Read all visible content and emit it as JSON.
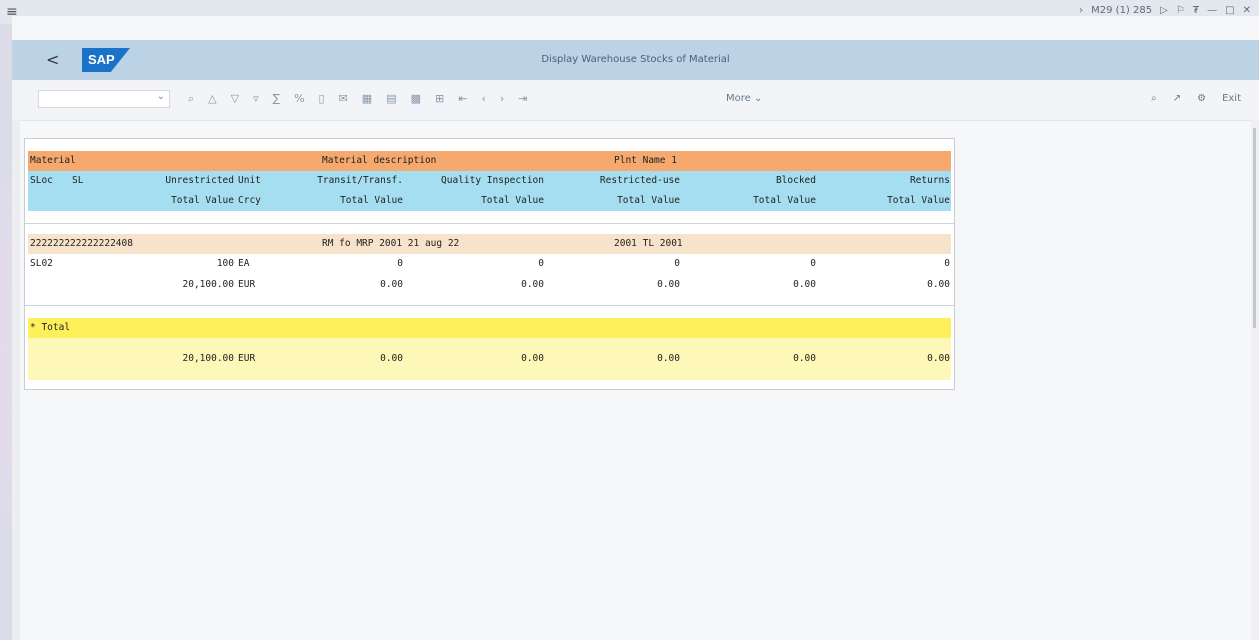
{
  "colors": {
    "header_orange": "#f5a96e",
    "header_blue": "#a5def0",
    "group_row": "#f7e3cc",
    "total_yellow": "#fdf05a",
    "total_values": "#fdf8b8",
    "sap_blue": "#1a73c9"
  },
  "titlebar": {
    "menu_icon": "hamburger-icon",
    "session": "M29 (1) 285",
    "icons": [
      "forward-icon",
      "play-icon",
      "flag-icon",
      "help-icon",
      "minimize-icon",
      "maximize-icon",
      "close-icon"
    ]
  },
  "shell": {
    "back": "<",
    "logo": "SAP",
    "title": "Display Warehouse Stocks of Material"
  },
  "toolbar": {
    "icons": [
      "find-icon",
      "sort-asc-icon",
      "sort-desc-icon",
      "filter-icon",
      "sum-icon",
      "subtotal-icon",
      "print-icon",
      "mail-icon",
      "layout-icon",
      "grid-icon",
      "export-icon",
      "spreadsheet-icon",
      "first-page-icon",
      "prev-page-icon",
      "next-page-icon",
      "last-page-icon"
    ],
    "more": "More",
    "right_icons": [
      "search-icon",
      "share-icon",
      "settings-icon"
    ],
    "exit": "Exit"
  },
  "report": {
    "header": {
      "row1": {
        "material": "Material",
        "desc": "Material description",
        "plant": "Plnt Name 1"
      },
      "row2": {
        "sloc": "SLoc",
        "sl": "SL",
        "unrestricted": "Unrestricted",
        "unit": "Unit",
        "transit": "Transit/Transf.",
        "quality": "Quality Inspection",
        "restricted": "Restricted-use",
        "blocked": "Blocked",
        "returns": "Returns"
      },
      "row3": {
        "total_value": "Total Value",
        "crcy": "Crcy",
        "tv1": "Total Value",
        "tv2": "Total Value",
        "tv3": "Total Value",
        "tv4": "Total Value",
        "tv5": "Total Value"
      }
    },
    "material_row": {
      "material": "222222222222222408",
      "desc": "RM fo MRP 2001 21 aug 22",
      "plant": "2001 TL 2001"
    },
    "qty_row": {
      "sloc": "SL02",
      "unrestricted": "100",
      "unit": "EA",
      "transit": "0",
      "quality": "0",
      "restricted": "0",
      "blocked": "0",
      "returns": "0"
    },
    "value_row": {
      "total_value": "20,100.00",
      "crcy": "EUR",
      "transit": "0.00",
      "quality": "0.00",
      "restricted": "0.00",
      "blocked": "0.00",
      "returns": "0.00"
    },
    "total_label": "* Total",
    "total_row": {
      "total_value": "20,100.00",
      "crcy": "EUR",
      "transit": "0.00",
      "quality": "0.00",
      "restricted": "0.00",
      "blocked": "0.00",
      "returns": "0.00"
    }
  }
}
